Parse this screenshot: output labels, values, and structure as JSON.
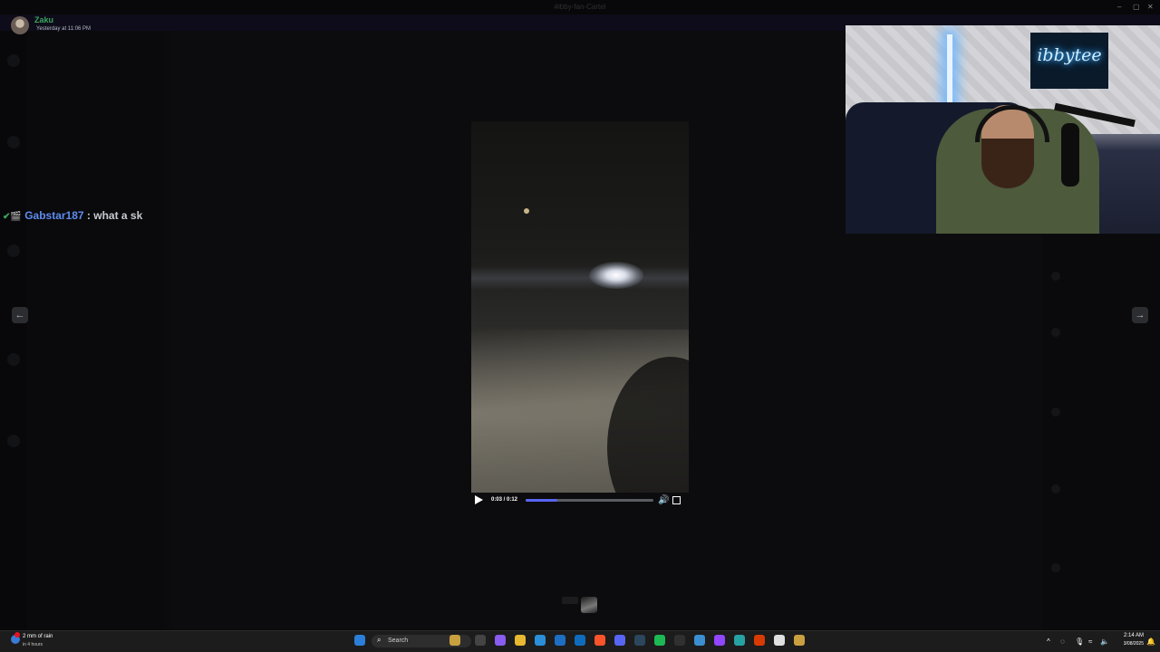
{
  "window": {
    "title": "#ibby-fan-Cartel",
    "minimize": "–",
    "maximize": "▢",
    "close": "✕"
  },
  "post": {
    "author": "Zaku",
    "timestamp": "Yesterday at 11:06 PM"
  },
  "live_chat": {
    "badge": "✔🎬",
    "username": "Gabstar187",
    "message": ": what a sk"
  },
  "nav": {
    "prev": "←",
    "next": "→"
  },
  "video": {
    "time": "0:03 / 0:12",
    "progress": 0.25,
    "volume_icon": "speaker-icon",
    "fullscreen_icon": "fullscreen-icon"
  },
  "webcam": {
    "sign_text": "ibbytee"
  },
  "taskbar": {
    "weather_line1": "2 mm of rain",
    "weather_line2": "in 4 hours",
    "search_placeholder": "Search",
    "clock_time": "2:14 AM",
    "clock_date": "3/08/2025"
  },
  "colors": {
    "accent": "#5865f2",
    "author": "#3ba55d",
    "chat_name": "#5e8cf0",
    "neon": "#39a8ff"
  }
}
